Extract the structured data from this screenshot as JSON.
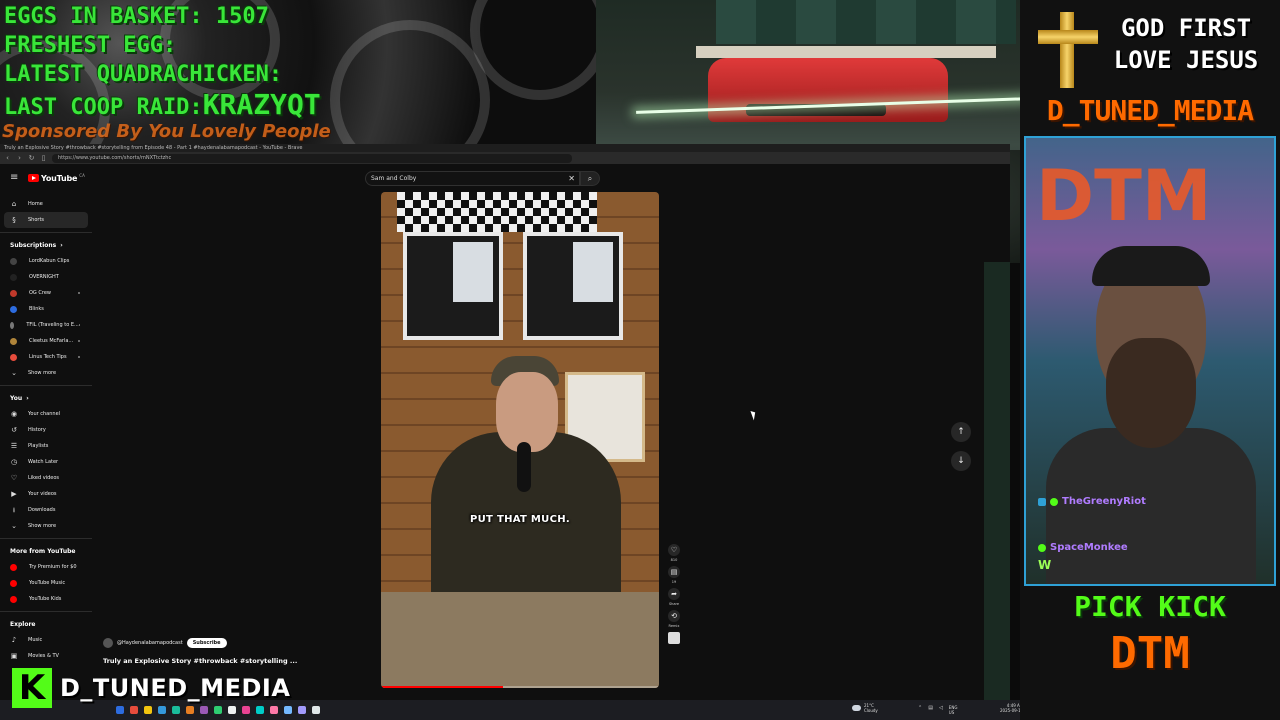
{
  "overlay": {
    "eggs_label": "EGGS IN BASKET:",
    "eggs_value": "1507",
    "freshest_label": "FRESHEST EGG:",
    "quad_label": "LATEST QUADRACHICKEN:",
    "raid_label": "LAST COOP RAID:",
    "raid_value": "KRAZYQT",
    "sponsor": "Sponsored By You Lovely People",
    "colors": {
      "green": "#39e639",
      "orange": "#e06a1a"
    }
  },
  "browser": {
    "title": "Truly an Explosive Story #throwback #storytelling from Episode 48 - Part 1 #haydenalabamapodcast - YouTube - Brave",
    "url": "https://www.youtube.com/shorts/mNXTtctzhc"
  },
  "youtube": {
    "logo": "YouTube",
    "logo_country": "CA",
    "search_value": "Sam and Colby",
    "sidebar": {
      "home": "Home",
      "shorts": "Shorts",
      "subscriptions_head": "Subscriptions",
      "subscriptions": [
        {
          "label": "LordKabun Clips",
          "color": "#444"
        },
        {
          "label": "OVERNIGHT",
          "color": "#222"
        },
        {
          "label": "OG Crew",
          "color": "#c0392b"
        },
        {
          "label": "Blinks",
          "color": "#2d6cdf"
        },
        {
          "label": "TFIL (Traveling to E...",
          "color": "#777"
        },
        {
          "label": "Cleetus McFarla...",
          "color": "#b0853a"
        },
        {
          "label": "Linus Tech Tips",
          "color": "#e74c3c"
        }
      ],
      "show_more": "Show more",
      "you_head": "You",
      "you_items": [
        {
          "label": "Your channel",
          "icon": "channel-icon",
          "glyph": "◉"
        },
        {
          "label": "History",
          "icon": "history-icon",
          "glyph": "↺"
        },
        {
          "label": "Playlists",
          "icon": "playlists-icon",
          "glyph": "☰"
        },
        {
          "label": "Watch Later",
          "icon": "clock-icon",
          "glyph": "◷"
        },
        {
          "label": "Liked videos",
          "icon": "thumbs-up-icon",
          "glyph": "♡"
        },
        {
          "label": "Your videos",
          "icon": "videos-icon",
          "glyph": "▶"
        },
        {
          "label": "Downloads",
          "icon": "download-icon",
          "glyph": "⭳"
        }
      ],
      "you_show_more": "Show more",
      "more_head": "More from YouTube",
      "more_items": [
        {
          "label": "Try Premium for $0",
          "color": "#ff0000"
        },
        {
          "label": "YouTube Music",
          "color": "#ff0000"
        },
        {
          "label": "YouTube Kids",
          "color": "#ff0000"
        }
      ],
      "explore_head": "Explore",
      "explore_items": [
        {
          "label": "Music",
          "icon": "music-icon",
          "glyph": "♪"
        },
        {
          "label": "Movies & TV",
          "icon": "movie-icon",
          "glyph": "▣"
        }
      ]
    },
    "short": {
      "caption": "PUT THAT MUCH.",
      "channel": "@Haydenalabamapodcast",
      "subscribe": "Subscribe",
      "title": "Truly an Explosive Story #throwback #storytelling ...",
      "progress": 0.44,
      "actions": [
        {
          "icon": "like-icon",
          "glyph": "♡",
          "label": "810"
        },
        {
          "icon": "comment-icon",
          "glyph": "▤",
          "label": "19"
        },
        {
          "icon": "share-icon",
          "glyph": "➦",
          "label": "Share"
        },
        {
          "icon": "remix-icon",
          "glyph": "⟲",
          "label": "Remix"
        }
      ]
    },
    "nav": {
      "up": "↑",
      "down": "↓"
    }
  },
  "taskbar": {
    "weather_temp": "21°C",
    "weather_desc": "Cloudy",
    "lang": "ENG",
    "region": "US",
    "time": "4:49 AM",
    "date": "2025-09-10",
    "icons": [
      "#2d6cdf",
      "#e74c3c",
      "#f1c40f",
      "#3498db",
      "#1abc9c",
      "#e67e22",
      "#9b59b6",
      "#2ecc71",
      "#ecf0f1",
      "#e84393",
      "#00cec9",
      "#fd79a8",
      "#74b9ff",
      "#a29bfe",
      "#dfe6e9"
    ]
  },
  "kick_badge": {
    "letter": "K",
    "name": "D_TUNED_MEDIA"
  },
  "right": {
    "god_first": "GOD FIRST",
    "love_jesus": "LOVE JESUS",
    "media_title": "D_TUNED_MEDIA",
    "sign_text": "DTM",
    "chat": [
      {
        "user": "TheGreenyRiot",
        "color": "#b07cff"
      },
      {
        "user": "SpaceMonkee",
        "color": "#b07cff"
      }
    ],
    "chat_message": "W",
    "pick_kick": "PICK KICK",
    "dtm": "DTM"
  }
}
